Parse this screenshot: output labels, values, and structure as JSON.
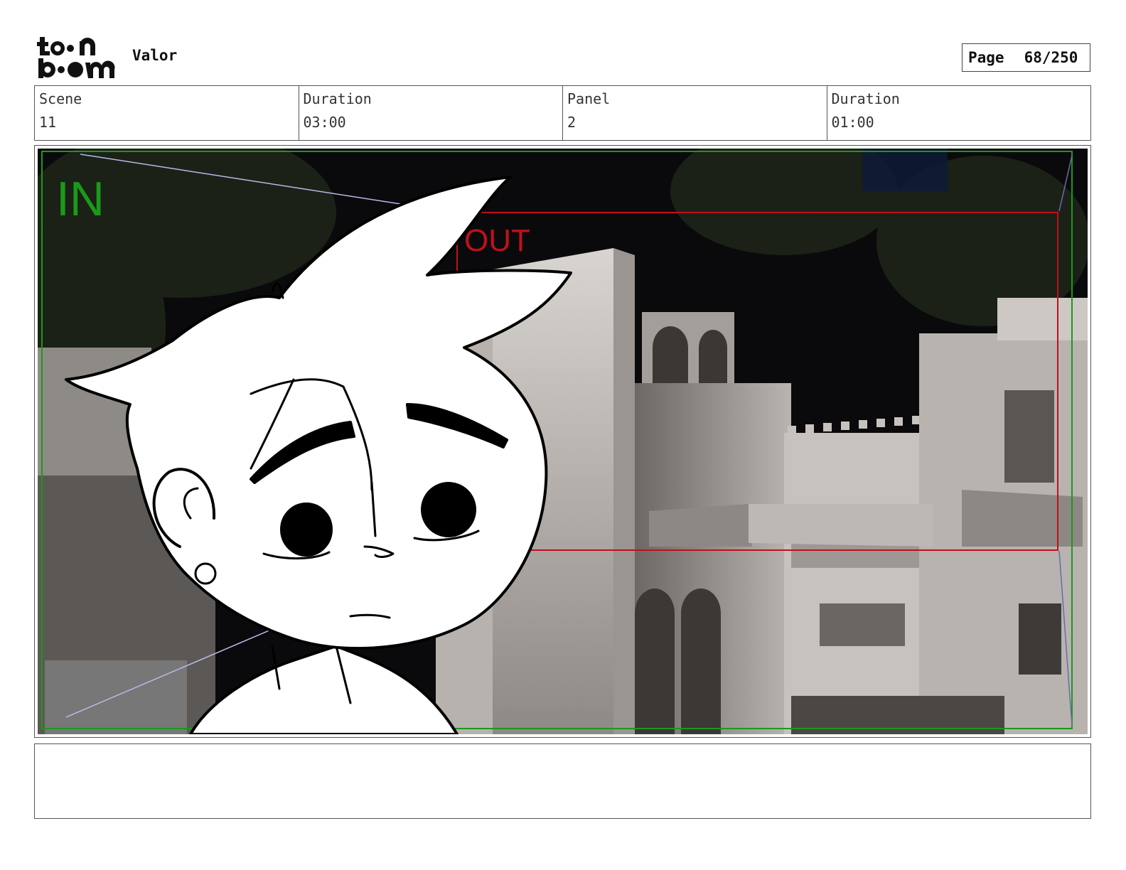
{
  "header": {
    "logo_text": [
      "to•n",
      "b•om"
    ],
    "project_title": "Valor",
    "page_label": "Page",
    "page_value": "68/250"
  },
  "info": [
    {
      "label": "Scene",
      "value": "11"
    },
    {
      "label": "Duration",
      "value": "03:00"
    },
    {
      "label": "Panel",
      "value": "2"
    },
    {
      "label": "Duration",
      "value": "01:00"
    }
  ],
  "panel": {
    "in_label": "IN",
    "out_label": "OUT",
    "colors": {
      "in_frame": "#1a9a1a",
      "out_frame": "#c0101a",
      "arrows": "#b8b8e8",
      "sky": "#0a0a0c"
    }
  },
  "notes": {
    "text": ""
  }
}
